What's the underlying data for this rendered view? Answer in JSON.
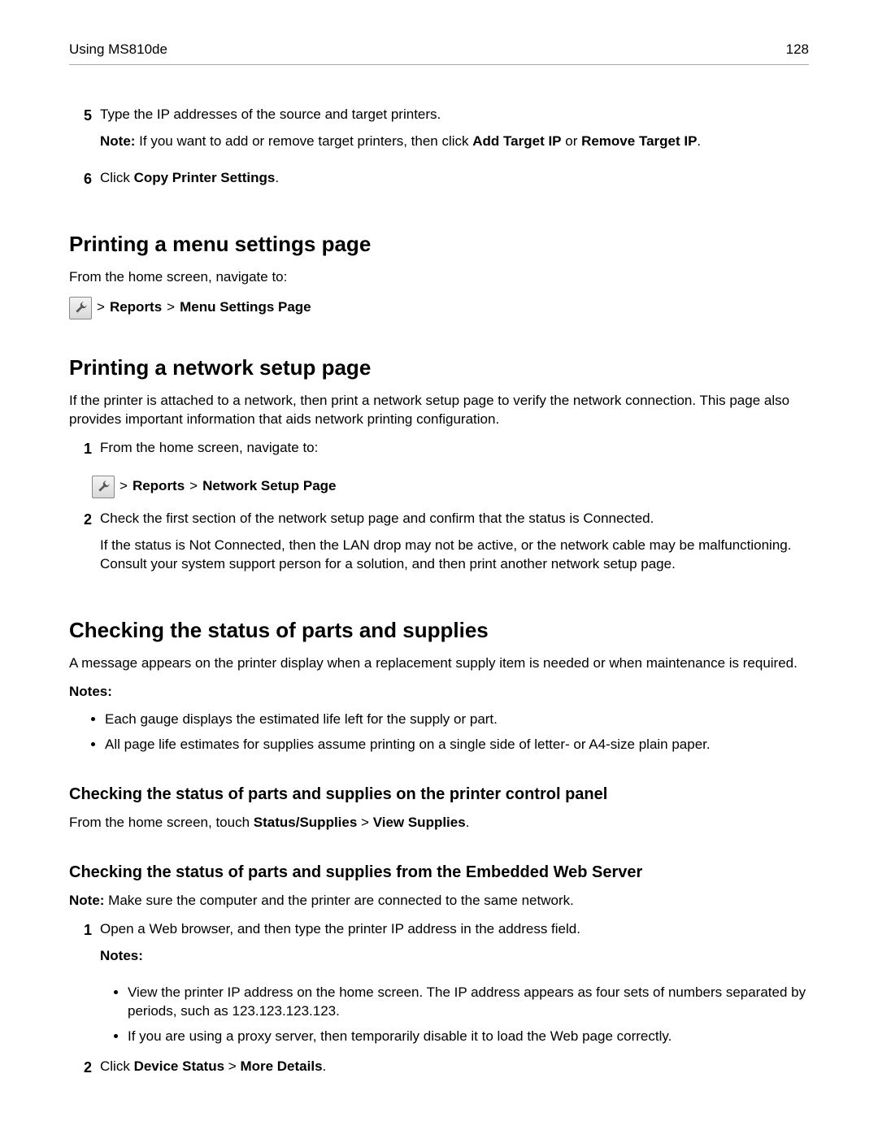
{
  "header": {
    "left": "Using MS810de",
    "right": "128"
  },
  "s5": {
    "num": "5",
    "line1": "Type the IP addresses of the source and target printers.",
    "note_label": "Note:",
    "note_rest": " If you want to add or remove target printers, then click ",
    "b1": "Add Target IP",
    "mid": " or ",
    "b2": "Remove Target IP",
    "end": "."
  },
  "s6": {
    "num": "6",
    "pre": "Click ",
    "b": "Copy Printer Settings",
    "end": "."
  },
  "menu": {
    "title": "Printing a menu settings page",
    "intro": "From the home screen, navigate to:",
    "path": {
      "gt1": ">",
      "p1": "Reports",
      "gt2": ">",
      "p2": "Menu Settings Page"
    }
  },
  "net": {
    "title": "Printing a network setup page",
    "intro": "If the printer is attached to a network, then print a network setup page to verify the network connection. This page also provides important information that aids network printing configuration.",
    "s1": {
      "num": "1",
      "text": "From the home screen, navigate to:"
    },
    "path": {
      "gt1": ">",
      "p1": "Reports",
      "gt2": ">",
      "p2": "Network Setup Page"
    },
    "s2": {
      "num": "2",
      "line1": "Check the first section of the network setup page and confirm that the status is Connected.",
      "line2": "If the status is Not Connected, then the LAN drop may not be active, or the network cable may be malfunctioning. Consult your system support person for a solution, and then print another network setup page."
    }
  },
  "status": {
    "title": "Checking the status of parts and supplies",
    "intro": "A message appears on the printer display when a replacement supply item is needed or when maintenance is required.",
    "notes_label": "Notes:",
    "bul1": "Each gauge displays the estimated life left for the supply or part.",
    "bul2": "All page life estimates for supplies assume printing on a single side of letter‑ or A4‑size plain paper."
  },
  "panel": {
    "title": "Checking the status of parts and supplies on the printer control panel",
    "pre": "From the home screen, touch ",
    "b1": "Status/Supplies",
    "mid": " > ",
    "b2": "View Supplies",
    "end": "."
  },
  "ews": {
    "title": "Checking the status of parts and supplies from the Embedded Web Server",
    "note_label": "Note:",
    "note_rest": " Make sure the computer and the printer are connected to the same network.",
    "s1": {
      "num": "1",
      "text": "Open a Web browser, and then type the printer IP address in the address field.",
      "notes_label": "Notes:",
      "bul1": "View the printer IP address on the home screen. The IP address appears as four sets of numbers separated by periods, such as 123.123.123.123.",
      "bul2": "If you are using a proxy server, then temporarily disable it to load the Web page correctly."
    },
    "s2": {
      "num": "2",
      "pre": "Click ",
      "b1": "Device Status",
      "mid": " > ",
      "b2": "More Details",
      "end": "."
    }
  }
}
